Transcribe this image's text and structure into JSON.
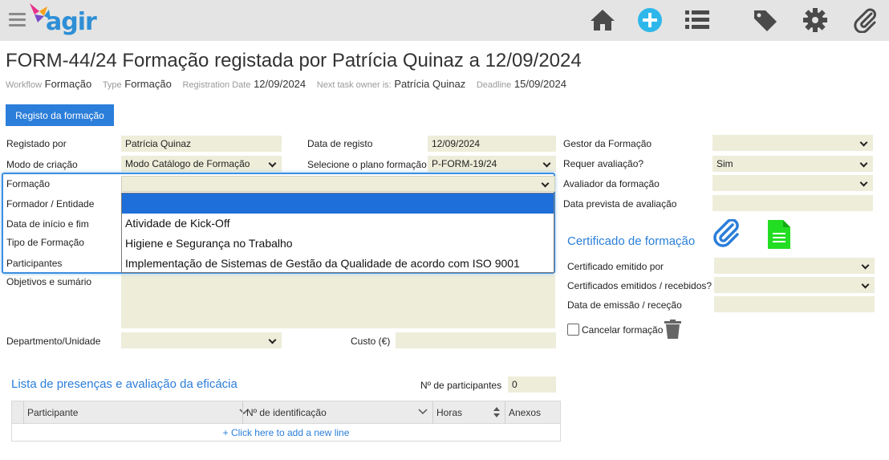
{
  "app": {
    "logo_text": "agir"
  },
  "topbar": {
    "icons": [
      "home-icon",
      "add-icon",
      "list-icon",
      "tags-icon",
      "gear-icon",
      "paperclip-icon"
    ]
  },
  "title": "FORM-44/24 Formação registada por Patrícia Quinaz a 12/09/2024",
  "meta": {
    "workflow_label": "Workflow",
    "workflow_value": "Formação",
    "type_label": "Type",
    "type_value": "Formação",
    "regdate_label": "Registration Date",
    "regdate_value": "12/09/2024",
    "owner_label": "Next task owner is:",
    "owner_value": "Patrícia Quinaz",
    "deadline_label": "Deadline",
    "deadline_value": "15/09/2024"
  },
  "tab_label": "Registo da formação",
  "form": {
    "registado_por_label": "Registado por",
    "registado_por_value": "Patrícia Quinaz",
    "data_registo_label": "Data de registo",
    "data_registo_value": "12/09/2024",
    "gestor_label": "Gestor da Formação",
    "gestor_value": "",
    "modo_label": "Modo de criação",
    "modo_value": "Modo Catálogo de Formação",
    "plano_label": "Selecione o plano formação",
    "plano_value": "P-FORM-19/24",
    "requer_label": "Requer avaliação?",
    "requer_value": "Sim",
    "formacao_label": "Formação",
    "formacao_value": "",
    "avaliador_label": "Avaliador da formação",
    "avaliador_value": "",
    "formador_label": "Formador / Entidade",
    "data_prevista_label": "Data prevista de avaliação",
    "data_prevista_value": "",
    "data_inicio_label": "Data de início e fim",
    "tipo_label": "Tipo de Formação",
    "participantes_label": "Participantes",
    "objetivos_label": "Objetivos e sumário",
    "departamento_label": "Departmento/Unidade",
    "departamento_value": "",
    "custo_label": "Custo (€)",
    "custo_value": ""
  },
  "formacao_dropdown": {
    "options": [
      "",
      "Atividade de Kick-Off",
      "Higiene e Segurança no Trabalho",
      "Implementação de Sistemas de Gestão da Qualidade de acordo com ISO 9001"
    ],
    "highlighted_index": 0
  },
  "certificado": {
    "title": "Certificado de formação",
    "emitido_por_label": "Certificado emitido por",
    "emitido_por_value": "",
    "emitidos_label": "Certificados emitidos / recebidos?",
    "emitidos_value": "",
    "data_emissao_label": "Data de emissão / receção",
    "data_emissao_value": "",
    "cancelar_label": "Cancelar formação",
    "cancelar_checked": false
  },
  "presencas": {
    "title": "Lista de presenças e avaliação da eficácia",
    "num_participantes_label": "Nº de participantes",
    "num_participantes_value": "0",
    "columns": [
      "Participante",
      "Nº de identificação",
      "Horas",
      "Anexos"
    ],
    "add_line": "+ Click here to add a new line"
  },
  "colors": {
    "accent": "#2b7ed9",
    "field_bg": "#ededda",
    "green_doc": "#22dd22"
  }
}
